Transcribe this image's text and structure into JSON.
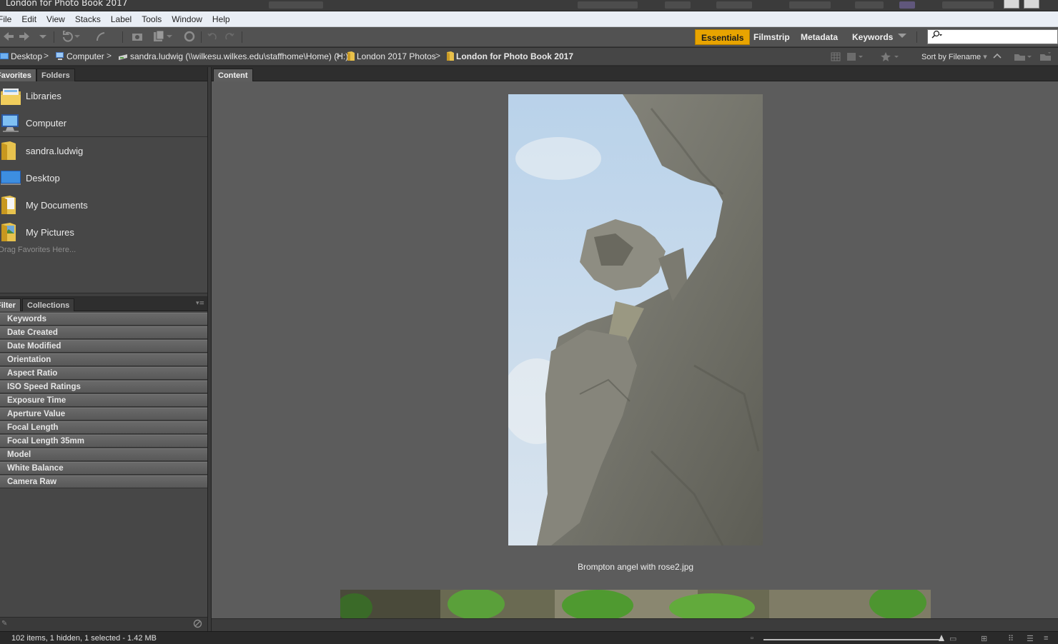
{
  "window": {
    "title": "London for Photo Book 2017"
  },
  "menu": [
    "File",
    "Edit",
    "View",
    "Stacks",
    "Label",
    "Tools",
    "Window",
    "Help"
  ],
  "workspaces": [
    {
      "label": "Essentials",
      "active": true
    },
    {
      "label": "Filmstrip",
      "active": false
    },
    {
      "label": "Metadata",
      "active": false
    },
    {
      "label": "Keywords",
      "active": false
    }
  ],
  "search": {
    "placeholder": ""
  },
  "breadcrumb": [
    {
      "label": "Desktop",
      "icon": "desktop-icon"
    },
    {
      "label": "Computer",
      "icon": "computer-icon"
    },
    {
      "label": "sandra.ludwig (\\\\wilkesu.wilkes.edu\\staffhome\\Home) (H:)",
      "icon": "network-drive-icon"
    },
    {
      "label": "London 2017 Photos",
      "icon": "folder-icon"
    },
    {
      "label": "London for Photo Book 2017",
      "icon": "folder-icon"
    }
  ],
  "sort": {
    "label": "Sort by Filename"
  },
  "panels": {
    "favorites_tab": "Favorites",
    "folders_tab": "Folders",
    "favorites": [
      {
        "label": "Libraries",
        "icon": "libraries-icon"
      },
      {
        "label": "Computer",
        "icon": "computer-icon"
      },
      {
        "label": "sandra.ludwig",
        "icon": "user-folder-icon"
      },
      {
        "label": "Desktop",
        "icon": "desktop-icon"
      },
      {
        "label": "My Documents",
        "icon": "documents-folder-icon"
      },
      {
        "label": "My Pictures",
        "icon": "pictures-folder-icon"
      }
    ],
    "drag_hint": "Drag Favorites Here...",
    "filter_tab": "Filter",
    "collections_tab": "Collections",
    "filters": [
      "Keywords",
      "Date Created",
      "Date Modified",
      "Orientation",
      "Aspect Ratio",
      "ISO Speed Ratings",
      "Exposure Time",
      "Aperture Value",
      "Focal Length",
      "Focal Length 35mm",
      "Model",
      "White Balance",
      "Camera Raw"
    ]
  },
  "content": {
    "tab": "Content",
    "items": [
      {
        "filename": "Brompton angel with rose2.jpg",
        "selected": true
      }
    ]
  },
  "status": {
    "text": "102 items, 1 hidden, 1 selected - 1.42 MB"
  },
  "colors": {
    "accent": "#e8a400",
    "panel": "#474747",
    "content_bg": "#5c5c5c"
  }
}
